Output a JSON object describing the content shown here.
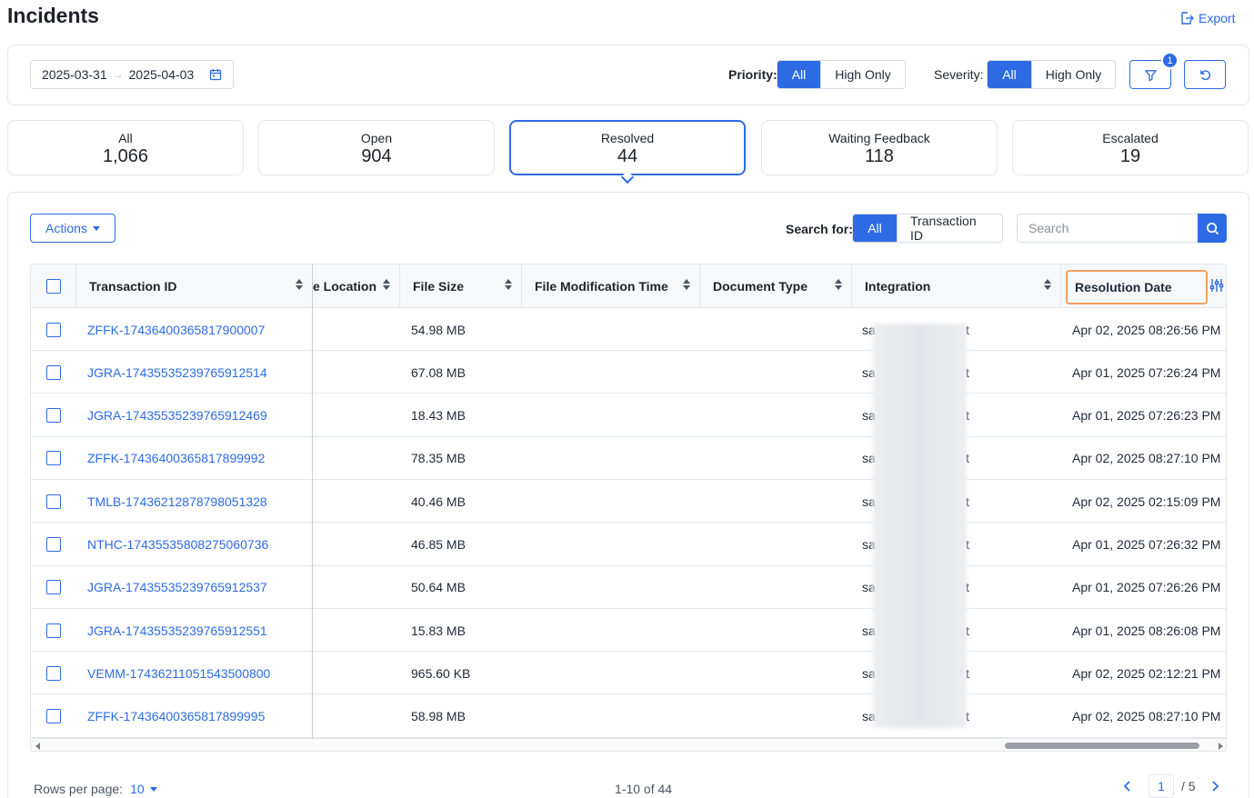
{
  "header": {
    "title": "Incidents",
    "export_label": "Export"
  },
  "filters": {
    "date_start": "2025-03-31",
    "date_end": "2025-04-03",
    "priority_label": "Priority:",
    "priority_options": [
      "All",
      "High Only"
    ],
    "severity_label": "Severity:",
    "severity_options": [
      "All",
      "High Only"
    ],
    "filter_badge": "1"
  },
  "cards": [
    {
      "label": "All",
      "value": "1,066"
    },
    {
      "label": "Open",
      "value": "904"
    },
    {
      "label": "Resolved",
      "value": "44"
    },
    {
      "label": "Waiting Feedback",
      "value": "118"
    },
    {
      "label": "Escalated",
      "value": "19"
    }
  ],
  "toolbar": {
    "actions_label": "Actions",
    "search_for_label": "Search for:",
    "search_options": [
      "All",
      "Transaction ID"
    ],
    "search_placeholder": "Search"
  },
  "table": {
    "columns": [
      "Transaction ID",
      "e Location",
      "File Size",
      "File Modification Time",
      "Document Type",
      "Integration",
      "Resolution Date"
    ],
    "rows": [
      {
        "id": "ZFFK-17436400365817900007",
        "size": "54.98 MB",
        "integration_a": "sa",
        "integration_b": "t",
        "date": "Apr 02, 2025 08:26:56 PM"
      },
      {
        "id": "JGRA-17435535239765912514",
        "size": "67.08 MB",
        "integration_a": "sa",
        "integration_b": "t",
        "date": "Apr 01, 2025 07:26:24 PM"
      },
      {
        "id": "JGRA-17435535239765912469",
        "size": "18.43 MB",
        "integration_a": "sa",
        "integration_b": "t",
        "date": "Apr 01, 2025 07:26:23 PM"
      },
      {
        "id": "ZFFK-17436400365817899992",
        "size": "78.35 MB",
        "integration_a": "sa",
        "integration_b": "t",
        "date": "Apr 02, 2025 08:27:10 PM"
      },
      {
        "id": "TMLB-17436212878798051328",
        "size": "40.46 MB",
        "integration_a": "sa",
        "integration_b": "t",
        "date": "Apr 02, 2025 02:15:09 PM"
      },
      {
        "id": "NTHC-17435535808275060736",
        "size": "46.85 MB",
        "integration_a": "sa",
        "integration_b": "t",
        "date": "Apr 01, 2025 07:26:32 PM"
      },
      {
        "id": "JGRA-17435535239765912537",
        "size": "50.64 MB",
        "integration_a": "sa",
        "integration_b": "t",
        "date": "Apr 01, 2025 07:26:26 PM"
      },
      {
        "id": "JGRA-17435535239765912551",
        "size": "15.83 MB",
        "integration_a": "sa",
        "integration_b": "t",
        "date": "Apr 01, 2025 08:26:08 PM"
      },
      {
        "id": "VEMM-17436211051543500800",
        "size": "965.60 KB",
        "integration_a": "sa",
        "integration_b": "t",
        "date": "Apr 02, 2025 02:12:21 PM"
      },
      {
        "id": "ZFFK-17436400365817899995",
        "size": "58.98 MB",
        "integration_a": "sa",
        "integration_b": "t",
        "date": "Apr 02, 2025 08:27:10 PM"
      }
    ]
  },
  "pagination": {
    "rows_per_page_label": "Rows per page:",
    "rows_per_page_value": "10",
    "range_text": "1-10 of 44",
    "current_page": "1",
    "total_pages": "/ 5"
  },
  "colors": {
    "accent": "#2d6be4",
    "highlight": "#f0a060",
    "border": "#e3e6ea"
  }
}
